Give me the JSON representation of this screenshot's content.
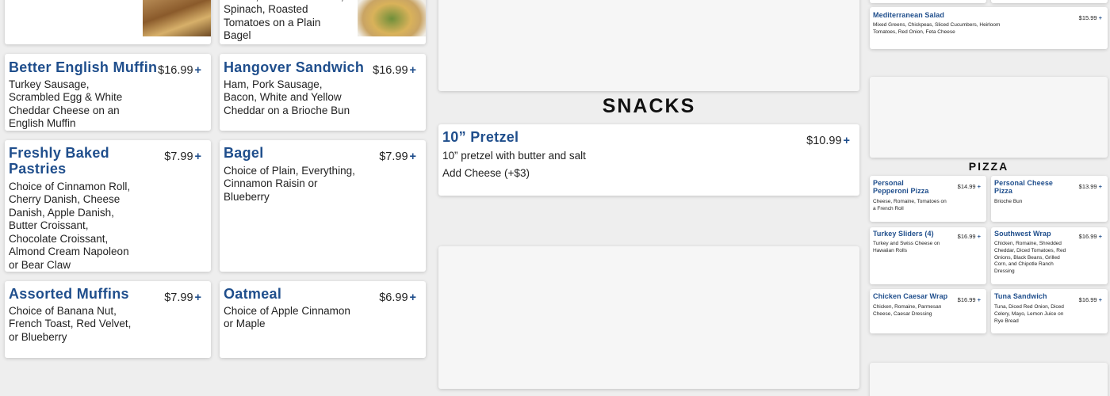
{
  "col1": {
    "top_card_desc": "",
    "items": [
      {
        "title": "Better English Muffin",
        "price": "$16.99",
        "desc": "Turkey Sausage, Scrambled Egg & White Cheddar Cheese on an English Muffin"
      },
      {
        "title": "Freshly Baked Pastries",
        "price": "$7.99",
        "desc": "Choice of Cinnamon Roll, Cherry Danish, Cheese Danish, Apple Danish, Butter Croissant, Chocolate Croissant, Almond Cream Napoleon or Bear Claw"
      },
      {
        "title": "Assorted Muffins",
        "price": "$7.99",
        "desc": "Choice of Banana Nut, French Toast, Red Velvet, or Blueberry"
      }
    ]
  },
  "col2": {
    "top_card_desc": "Gouda, Canadian Bacon, Spinach, Roasted Tomatoes on a Plain Bagel",
    "items": [
      {
        "title": "Hangover Sandwich",
        "price": "$16.99",
        "desc": "Ham, Pork Sausage, Bacon, White and Yellow Cheddar on a Brioche Bun"
      },
      {
        "title": "Bagel",
        "price": "$7.99",
        "desc": "Choice of Plain, Everything, Cinnamon Raisin or Blueberry"
      },
      {
        "title": "Oatmeal",
        "price": "$6.99",
        "desc": "Choice of Apple Cinnamon or Maple"
      }
    ]
  },
  "col3": {
    "section_title": "SNACKS",
    "pretzel": {
      "title": "10” Pretzel",
      "price": "$10.99",
      "desc": "10” pretzel with butter and salt",
      "addon": "Add Cheese (+$3)"
    }
  },
  "col4": {
    "salad": {
      "title": "Mediterranean Salad",
      "price": "$15.99",
      "desc": "Mixed Greens, Chickpeas, Sliced Cucumbers, Heirloom Tomatoes, Red Onion, Feta Cheese"
    },
    "pizza_title": "PIZZA",
    "items": [
      {
        "title": "Personal Pepperoni Pizza",
        "price": "$14.99",
        "desc": "Cheese, Romaine, Tomatoes on a French Roll"
      },
      {
        "title": "Personal Cheese Pizza",
        "price": "$13.99",
        "desc": "Brioche Bun"
      },
      {
        "title": "Turkey Sliders (4)",
        "price": "$16.99",
        "desc": "Turkey and Swiss Cheese on Hawaiian Rolls"
      },
      {
        "title": "Southwest Wrap",
        "price": "$16.99",
        "desc": "Chicken, Romaine, Shredded Cheddar, Diced Tomatoes, Red Onions, Black Beans, Grilled Corn, and Chipotle Ranch Dressing"
      },
      {
        "title": "Chicken Caesar Wrap",
        "price": "$16.99",
        "desc": "Chicken, Romaine, Parmesan Cheese, Caesar Dressing"
      },
      {
        "title": "Tuna Sandwich",
        "price": "$16.99",
        "desc": "Tuna, Diced Red Onion, Diced Celery, Mayo, Lemon Juice on Rye Bread"
      }
    ]
  },
  "add_symbol": "+",
  "colors": {
    "accent": "#1f4e8c",
    "card": "#ffffff",
    "background": "#eeeeee"
  }
}
